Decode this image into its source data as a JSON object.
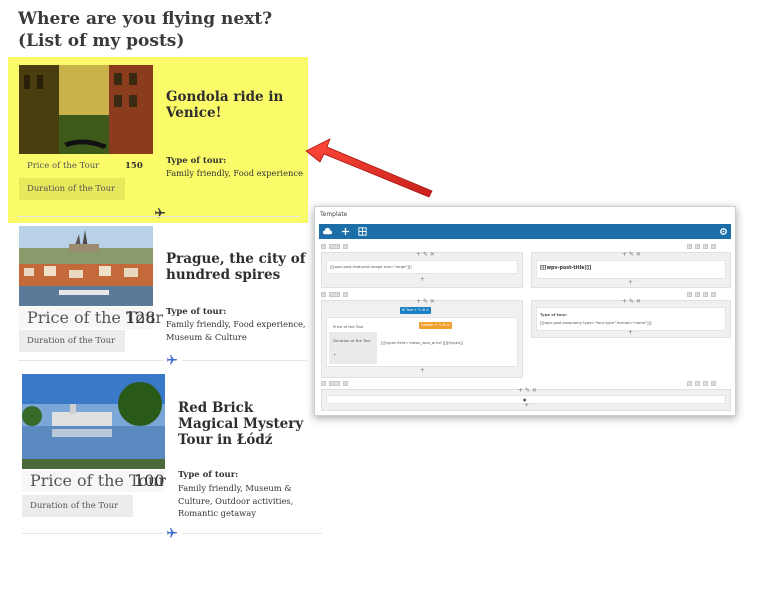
{
  "page": {
    "heading": "Where are you flying next? (List of my posts)"
  },
  "posts": [
    {
      "title": "Gondola ride in Venice!",
      "price_label": "Price of the Tour",
      "price_value": "150",
      "duration_label": "Duration of the Tour",
      "type_label": "Type of tour:",
      "type_value": "Family friendly, Food experience",
      "highlighted": true
    },
    {
      "title": "Prague, the city of hundred spires",
      "price_label": "Price of the Tour",
      "price_value": "128",
      "duration_label": "Duration of the Tour",
      "type_label": "Type of tour:",
      "type_value": "Family friendly, Food experience, Museum & Culture",
      "highlighted": false
    },
    {
      "title": "Red Brick Magical Mystery Tour in Łódź",
      "price_label": "Price of the Tour",
      "price_value": "100",
      "duration_label": "Duration of the Tour",
      "type_label": "Type of tour:",
      "type_value": "Family friendly, Museum & Culture, Outdoor activities, Romantic getaway",
      "highlighted": false
    }
  ],
  "editor": {
    "title": "Template",
    "row1_left_code": "[[[wpv-post-featured-image size=\"large\"]]]",
    "row1_right_code": "[[[wpv-post-title]]]",
    "row2_chip_blue": "Text",
    "row2_price_label": "Price of the Tour",
    "row2_duration_label": "Duration of the Tour",
    "row2_chip_orange": "Header",
    "row2_types_code": "[[[types field='views_woo_price']]][/types]]",
    "row2_right_label": "Type of tour:",
    "row2_right_code": "[[[wpv-post-taxonomy type=\"tour-type\" format=\"name\"]]]"
  },
  "colors": {
    "highlight": "#fbfb6a",
    "toolbar": "#1b6ea7",
    "arrow": "#e8302a",
    "plane": "#3d6fd0"
  }
}
